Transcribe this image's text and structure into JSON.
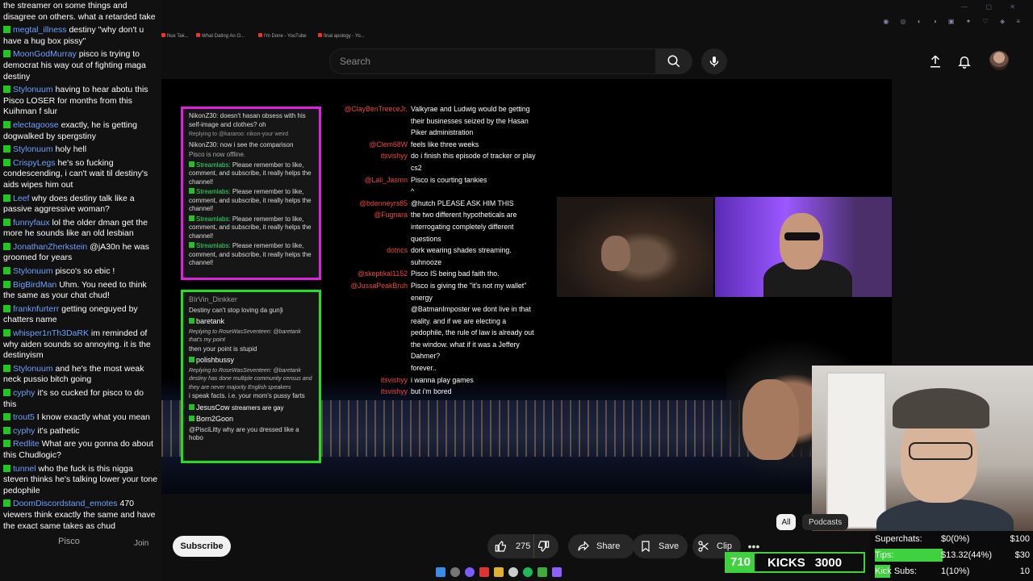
{
  "chat": [
    {
      "user": "",
      "text": "the streamer on some things and disagree on others. what a retarded take"
    },
    {
      "user": "megtal_illness",
      "text": "destiny \"why don't u have a hug box pissy\""
    },
    {
      "user": "MoonGodMurray",
      "text": "pisco is trying to democrat his way out of fighting maga destiny"
    },
    {
      "user": "Stylonuum",
      "text": "having to hear abotu this Pisco LOSER for months from this Kuihman f slur"
    },
    {
      "user": "electagoose",
      "text": "exactly, he is getting dogwalked by spergstiny"
    },
    {
      "user": "Stylonuum",
      "text": "holy hell"
    },
    {
      "user": "CrispyLegs",
      "text": "he's so fucking condescending, i can't wait til destiny's aids wipes him out"
    },
    {
      "user": "Leef",
      "text": "why does destiny talk like a passive aggressive woman?"
    },
    {
      "user": "funnyfaux",
      "text": "lol the older dman get the more he sounds like an old lesbian"
    },
    {
      "user": "JonathanZherkstein",
      "text": "@jA30n he was groomed for years"
    },
    {
      "user": "Stylonuum",
      "text": "pisco's so ebic !"
    },
    {
      "user": "BigBirdMan",
      "text": "Uhm. You need to think the same as your chat chud!"
    },
    {
      "user": "franknfurterr",
      "text": "getting oneguyed by chatters name"
    },
    {
      "user": "whisper1nTh3DaRK",
      "text": "im reminded of why aiden sounds so annoying. it is the destinyism"
    },
    {
      "user": "Stylonuum",
      "text": "and he's the most weak neck pussio bitch going"
    },
    {
      "user": "cyphy",
      "text": "it's so cucked for pisco to do this"
    },
    {
      "user": "trout5",
      "text": "I know exactly what you mean"
    },
    {
      "user": "cyphy",
      "text": "it's pathetic"
    },
    {
      "user": "Redlite",
      "text": "What are you gonna do about this Chudlogic?"
    },
    {
      "user": "tunnel",
      "text": "who the fuck is this nigga steven thinks he's talking lower your tone pedophile"
    },
    {
      "user": "DoomDiscordstand_emotes",
      "text": "470 viewers think exactly the same and have the exact same takes as chud"
    }
  ],
  "bookmarks": [
    "Nux Tak...",
    "What Dating An O...",
    "I'm Done - YouTube",
    "final apology - Yo..."
  ],
  "search": {
    "placeholder": "Search"
  },
  "video": {
    "panel_a": {
      "header": "NikonZ30: doesn't hasan obsess with his self-image and clothes? oh",
      "reply_to": "Replying to @kararoo: nikon-your weird",
      "reply_text": "NikonZ30: now i see the comparison",
      "offline": "Pisco is now offline.",
      "streamlabs_user": "Streamlabs:",
      "streamlabs_msg": "Please remember to like, comment, and subscribe, it really helps the channel!"
    },
    "panel_b": {
      "top_name": "BIrVin_Dinkker",
      "line1": "Destiny can't stop loving da gun]i",
      "name1": "baretank",
      "reply1": "Replying to RoseWasSeventeen: @baretank that's my point",
      "text1": "then your point is stupid",
      "name2": "polishbussy",
      "reply2": "Replying to RoseWasSeventeen: @baretank destiny has done multiple community census and they are never majority English speakers",
      "text2": "i speak facts. i.e. your mom's pussy farts",
      "name3": "JesusCow",
      "text3": "streamers are gay",
      "name4": "Born2Goon",
      "text4": "@PisciLitty why are you dressed like a hobo"
    },
    "center_chat": [
      {
        "user": "@ClayBenTreeceJr.",
        "text": "Valkyrae and Ludwig would be getting their businesses seized by the Hasan Piker administration"
      },
      {
        "user": "@Clem68W",
        "text": "feels like three weeks"
      },
      {
        "user": "itsvishyy",
        "text": "do i finish this episode of tracker or play cs2"
      },
      {
        "user": "@Lali_Jasmn",
        "text": "Pisco is courting tankies"
      },
      {
        "user": "",
        "text": "^"
      },
      {
        "user": "@bdenneyrs85",
        "text": "@hutch PLEASE ASK HIM THIS"
      },
      {
        "user": "@Fugnara",
        "text": "the two different hypotheticals are interrogating completely different questions"
      },
      {
        "user": "dotncs",
        "text": "dork wearing shades streaming. suhnooze"
      },
      {
        "user": "@skeptikal1152",
        "text": "Pisco IS being bad faith tho."
      },
      {
        "user": "@JussaPeakBruh",
        "text": "Pisco is giving the \"it's not my wallet\" energy"
      },
      {
        "user": "",
        "text": "@BatmanImposter we dont live in that reality. and if we are electing a pedophile, the rule of law is already out the window. what if it was a Jeffery Dahmer?"
      },
      {
        "user": "",
        "text": "forever.."
      },
      {
        "user": "itsvishyy",
        "text": "i wanna play games"
      },
      {
        "user": "itsvishyy",
        "text": "but i'm bored"
      }
    ]
  },
  "channel": {
    "name": "Pisco",
    "join": "Join",
    "subscribe": "Subscribe"
  },
  "actions": {
    "likes": "275",
    "share": "Share",
    "save": "Save",
    "clip": "Clip"
  },
  "chips": {
    "all": "All",
    "second": "Podcasts"
  },
  "overlay": {
    "kicks_count": "710",
    "kicks_label": "KICKS",
    "kicks_goal": "3000",
    "superchats_label": "Superchats:",
    "superchats_value": "$0(0%)",
    "superchats_goal": "$100",
    "tips_label": "Tips:",
    "tips_value": "$13.32(44%)",
    "tips_goal": "$30",
    "tips_progress": 0.44,
    "kicksubs_label": "Kick Subs:",
    "kicksubs_value": "1(10%)",
    "kicksubs_goal": "10",
    "kicksubs_progress": 0.1
  },
  "colors": {
    "accent_green": "#3fd23f",
    "panel_a_border": "#e020e0",
    "panel_b_border": "#20e020",
    "chat_user": "#6fa0ff"
  }
}
